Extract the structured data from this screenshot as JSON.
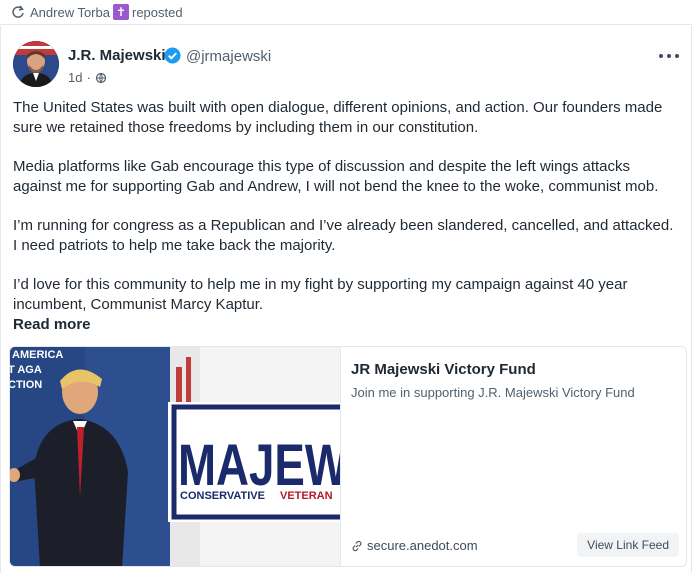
{
  "repost": {
    "user": "Andrew Torba",
    "badge": "✝",
    "action": "reposted"
  },
  "post": {
    "author_name": "J.R. Majewski",
    "handle": "@jrmajewski",
    "time": "1d",
    "paragraphs": [
      "The United States was built with open dialogue, different opinions, and action. Our founders made sure we retained those freedoms by including them in our constitution.",
      "Media platforms like Gab encourage this type of discussion and despite the left wings attacks against me for supporting Gab and Andrew, I will not bend the knee to the woke, communist mob.",
      "I’m running for congress as a Republican and I’ve already been slandered, cancelled, and attacked. I need patriots to help me take back the majority.",
      "I’d love for this community to help me in my fight by supporting my campaign against 40 year incumbent, Communist Marcy Kaptur."
    ],
    "read_more": "Read more"
  },
  "link_card": {
    "title": "JR Majewski Victory Fund",
    "description": "Join me in supporting J.R. Majewski Victory Fund",
    "domain": "secure.anedot.com",
    "view_button": "View Link Feed",
    "image_text": {
      "banner_line1": "AMERICA",
      "banner_line2": "T AGA",
      "banner_line3": "CTION",
      "sign_main": "MAJEW",
      "sign_sub1": "CONSERVATIVE",
      "sign_sub2": "VETERAN"
    }
  },
  "colors": {
    "text": "#1f2933",
    "muted": "#52606d",
    "verified_blue": "#1d9bf0",
    "sign_navy": "#1b2a6b",
    "sign_red": "#b3192b"
  }
}
